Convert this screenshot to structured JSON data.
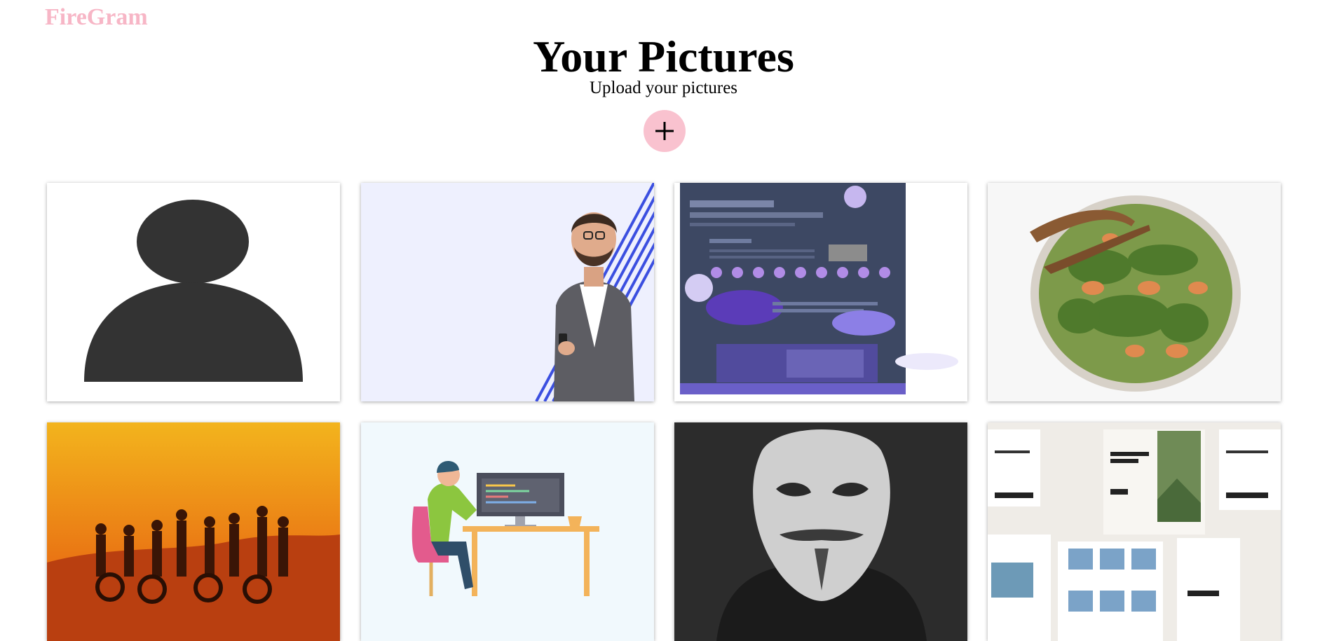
{
  "header": {
    "logo": "FireGram",
    "title": "Your Pictures",
    "subtitle": "Upload your pictures"
  },
  "upload_button": {
    "icon": "plus-icon"
  },
  "colors": {
    "logo": "#f7b6c6",
    "upload_button": "#f9c2cf"
  },
  "gallery": {
    "cards": [
      {
        "icon": "default-avatar-icon"
      },
      {
        "icon": "businessman-with-phone-image"
      },
      {
        "icon": "portfolio-website-screenshot-image"
      },
      {
        "icon": "shrimp-salad-bowl-image"
      },
      {
        "icon": "bikers-at-sunset-image"
      },
      {
        "icon": "developer-at-desk-illustration"
      },
      {
        "icon": "guy-fawkes-mask-image"
      },
      {
        "icon": "camping-app-ui-screens-image"
      }
    ]
  }
}
